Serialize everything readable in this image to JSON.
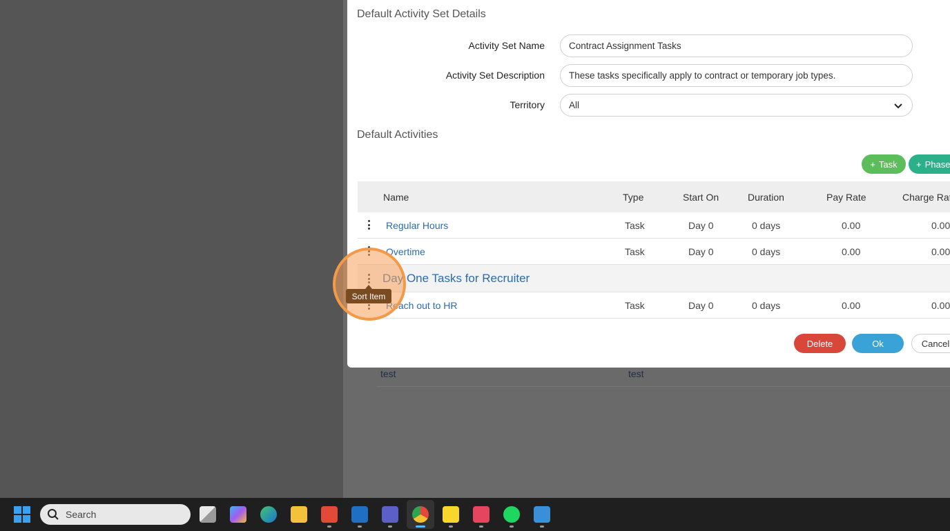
{
  "background": {
    "row": {
      "name": "test",
      "type": "test"
    }
  },
  "modal": {
    "details_title": "Default Activity Set Details",
    "fields": {
      "name_label": "Activity Set Name",
      "name_value": "Contract Assignment Tasks",
      "description_label": "Activity Set Description",
      "description_value": "These tasks specifically apply to contract or temporary job types.",
      "territory_label": "Territory",
      "territory_value": "All"
    },
    "activities_title": "Default Activities",
    "add_task_label": "Task",
    "add_phase_label": "Phase",
    "table": {
      "columns": [
        "Name",
        "Type",
        "Start On",
        "Duration",
        "Pay Rate",
        "Charge Rate"
      ],
      "rows": [
        {
          "name": "Regular Hours",
          "type": "Task",
          "start": "Day 0",
          "duration": "0 days",
          "pay": "0.00",
          "charge": "0.00"
        },
        {
          "name": "Overtime",
          "type": "Task",
          "start": "Day 0",
          "duration": "0 days",
          "pay": "0.00",
          "charge": "0.00"
        },
        {
          "phase": "Day One Tasks for Recruiter"
        },
        {
          "name": "Reach out to HR",
          "type": "Task",
          "start": "Day 0",
          "duration": "0 days",
          "pay": "0.00",
          "charge": "0.00"
        }
      ]
    },
    "buttons": {
      "delete": "Delete",
      "ok": "Ok",
      "cancel": "Cancel"
    }
  },
  "tooltip": "Sort Item",
  "taskbar": {
    "search_placeholder": "Search",
    "apps": [
      "task-view",
      "copilot",
      "edge",
      "file-explorer",
      "snagit",
      "outlook",
      "teams",
      "chrome",
      "sticky-notes",
      "wunderlist",
      "spotify",
      "snagit-editor"
    ]
  },
  "colors": {
    "delete": "#d9473b",
    "ok": "#39a3d8",
    "task_button": "#5cbe5a",
    "phase_button": "#2bb08a",
    "link": "#2a6bb0",
    "highlight": "#f39a4a"
  }
}
